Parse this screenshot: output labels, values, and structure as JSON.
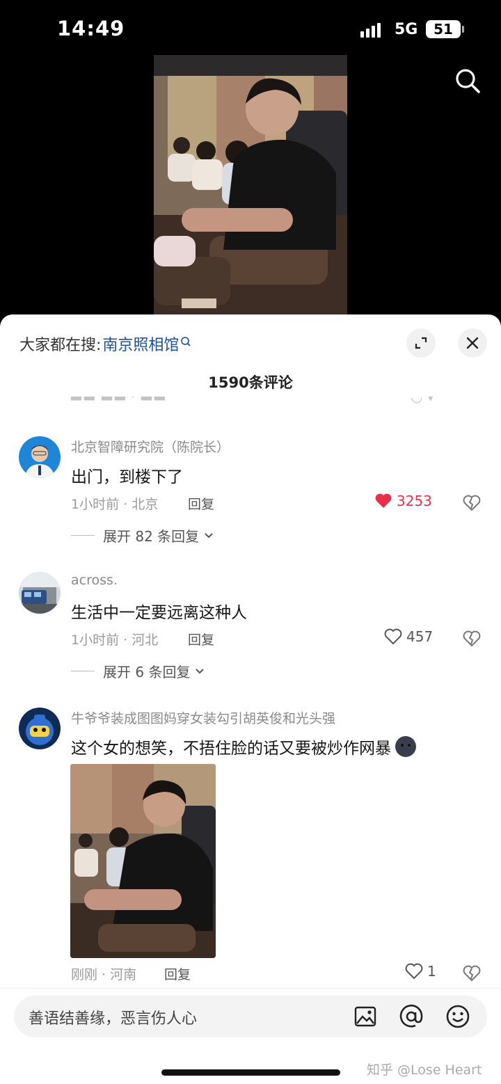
{
  "status_bar": {
    "time": "14:49",
    "network": "5G",
    "battery": "51"
  },
  "sheet": {
    "hot_search_label": "大家都在搜:",
    "hot_search_term": "南京照相馆",
    "comment_count": "1590条评论"
  },
  "comments": [
    {
      "name": "北京智障研究院（陈院长）",
      "text": "出门，到楼下了",
      "meta": "1小时前 · 北京",
      "reply": "回复",
      "likes": "3253",
      "liked": true,
      "expand": "展开 82 条回复"
    },
    {
      "name": "across.",
      "text": "生活中一定要远离这种人",
      "meta": "1小时前 · 河北",
      "reply": "回复",
      "likes": "457",
      "liked": false,
      "expand": "展开 6 条回复"
    },
    {
      "name": "牛爷爷装成图图妈穿女装勾引胡英俊和光头强",
      "text": "这个女的想笑，不捂住脸的话又要被炒作网暴",
      "meta": "刚刚 · 河南",
      "reply": "回复",
      "likes": "1",
      "liked": false
    }
  ],
  "input": {
    "placeholder": "善语结善缘，恶言伤人心",
    "icons": [
      "image-icon",
      "at-icon",
      "emoji-icon"
    ]
  },
  "watermark": "知乎 @Lose Heart",
  "colors": {
    "accent_link": "#1d4f9c",
    "like_red": "#e8304a"
  }
}
